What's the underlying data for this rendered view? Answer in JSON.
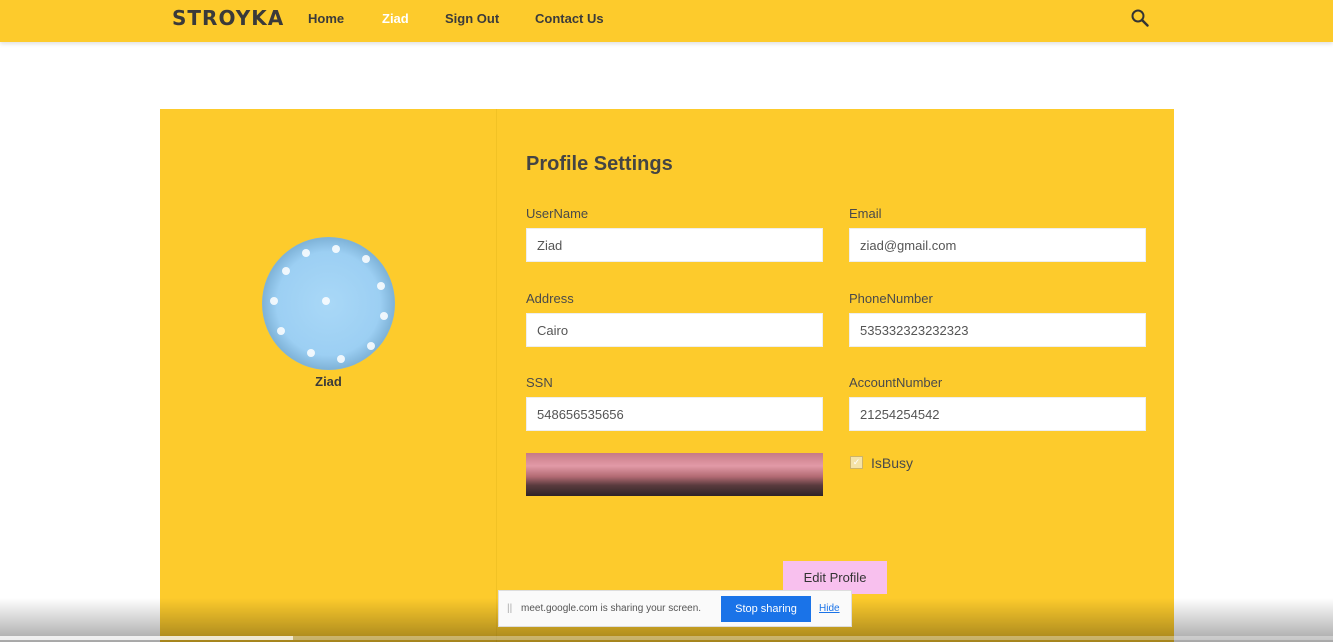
{
  "nav": {
    "logo": "STROYKA",
    "links": [
      {
        "label": "Home",
        "active": false
      },
      {
        "label": "Ziad",
        "active": true
      },
      {
        "label": "Sign Out",
        "active": false
      },
      {
        "label": "Contact Us",
        "active": false
      }
    ],
    "search_icon": "search-icon"
  },
  "profile": {
    "name": "Ziad",
    "title": "Profile Settings",
    "fields": {
      "username": {
        "label": "UserName",
        "value": "Ziad"
      },
      "email": {
        "label": "Email",
        "value": "ziad@gmail.com"
      },
      "address": {
        "label": "Address",
        "value": "Cairo"
      },
      "phone": {
        "label": "PhoneNumber",
        "value": "535332323232323"
      },
      "ssn": {
        "label": "SSN",
        "value": "548656535656"
      },
      "account": {
        "label": "AccountNumber",
        "value": "21254254542"
      }
    },
    "is_busy": {
      "label": "IsBusy",
      "checked": true
    },
    "edit_button": "Edit Profile"
  },
  "share_bar": {
    "message": "meet.google.com is sharing your screen.",
    "stop_label": "Stop sharing",
    "hide_label": "Hide"
  },
  "colors": {
    "brand_yellow": "#fdcb2c",
    "edit_button_pink": "#f8c0ee",
    "stop_button_blue": "#1a73e8"
  },
  "player": {
    "progress": 0.22
  }
}
